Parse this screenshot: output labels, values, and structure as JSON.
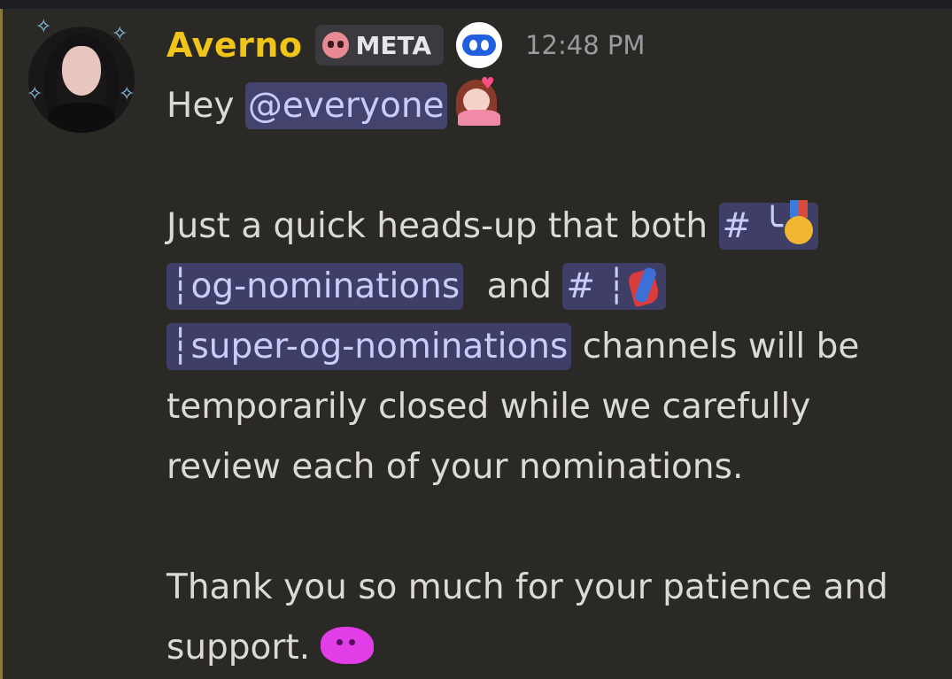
{
  "message": {
    "author": "Averno",
    "role_tag": {
      "icon": "skull-icon",
      "label": "META"
    },
    "app_badge_icon": "robot-face-icon",
    "timestamp": "12:48 PM",
    "greeting": "Hey",
    "mention": "@everyone",
    "lines": {
      "l2_text": "Just a quick heads-up that both",
      "channel1_prefix": "# ╰",
      "channel1_name": "┆og-nominations",
      "and_text": "and",
      "channel2_prefix": "# ┆",
      "channel2_name": "┆super-og-nominations",
      "l4_rest": " channels will be",
      "l5": "temporarily closed while we carefully",
      "l6": "review each of your nominations.",
      "l8": "Thank you so much for your patience and",
      "l9": "support."
    }
  },
  "colors": {
    "background": "#2b2925",
    "username": "#f0c418",
    "mention_bg": "#44436e",
    "mention_text": "#c9cdfb",
    "timestamp": "#9a9a9f"
  }
}
